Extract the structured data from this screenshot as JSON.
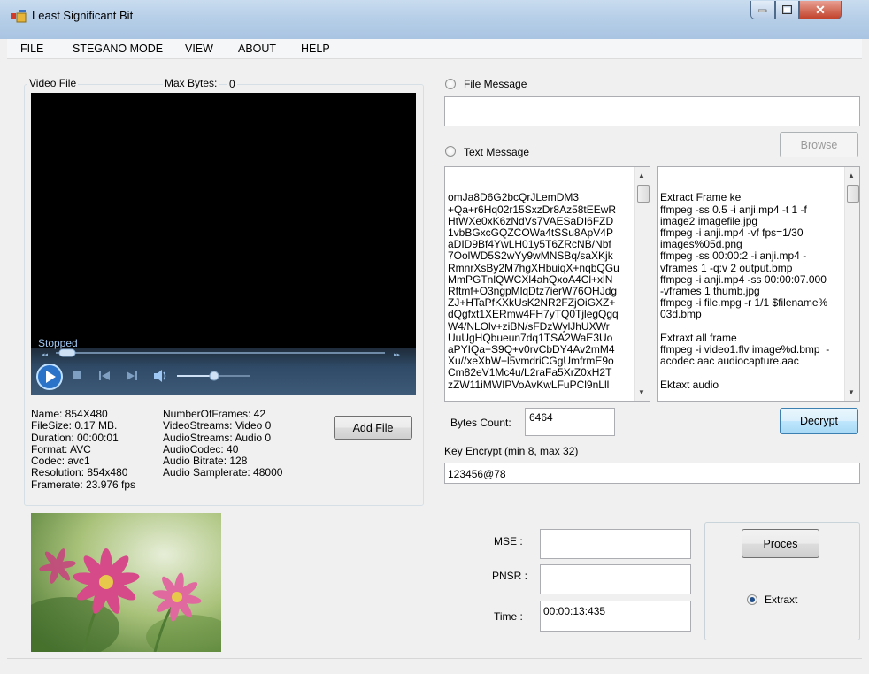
{
  "window": {
    "title": "Least Significant Bit"
  },
  "menu": {
    "items": [
      "FILE",
      "STEGANO MODE",
      "VIEW",
      "ABOUT",
      "HELP"
    ]
  },
  "video_panel": {
    "group_label": "Video File",
    "max_bytes_label": "Max Bytes:",
    "max_bytes_value": "0",
    "player_status": "Stopped"
  },
  "file_info": {
    "left": [
      "Name:    854X480",
      "FileSize: 0.17 MB.",
      "Duration: 00:00:01",
      "Format: AVC",
      "Codec: avc1",
      "Resolution: 854x480",
      "Framerate: 23.976 fps"
    ],
    "right": [
      "NumberOfFrames: 42",
      "VideoStreams: Video 0",
      "AudioStreams: Audio 0",
      "AudioCodec: 40",
      "Audio Bitrate: 128",
      "Audio Samplerate: 48000"
    ],
    "add_file_label": "Add File"
  },
  "message": {
    "file_message_label": "File Message",
    "file_message_value": "",
    "browse_label": "Browse",
    "text_message_label": "Text Message",
    "ciphertext_lines": [
      "omJa8D6G2bcQrJLemDM3",
      "+Qa+r6Hq02r15SxzDr8Az58tEEwR",
      "HtWXe0xK6zNdVs7VAESaDI6FZD",
      "1vbBGxcGQZCOWa4tSSu8ApV4P",
      "aDID9Bf4YwLH01y5T6ZRcNB/Nbf",
      "7OolWD5S2wYy9wMNSBq/saXKjk",
      "RmnrXsBy2M7hgXHbuiqX+nqbQGu",
      "MmPGTnlQWCXl4ahQxoA4Cl+xlN",
      "Rftmf+O3ngpMlqDtz7ierW76OHJdg",
      "ZJ+HTaPfKXkUsK2NR2FZjOiGXZ+",
      "dQgfxt1XERmw4FH7yTQ0TjlegQgq",
      "W4/NLOlv+ziBN/sFDzWylJhUXWr",
      "UuUgHQbueun7dq1TSA2WaE3Uo",
      "aPYIQa+S9Q+v0rvCbDY4Av2mM4",
      "Xu//xeXbW+l5vmdriCGgUmfrmE9o",
      "Cm82eV1Mc4u/L2raFa5XrZ0xH2T",
      "zZW11iMWIPVoAvKwLFuPCl9nLll"
    ],
    "notes_lines": [
      "Extract Frame ke",
      "ffmpeg -ss 0.5 -i anji.mp4 -t 1 -f",
      "image2 imagefile.jpg",
      "ffmpeg -i anji.mp4 -vf fps=1/30",
      "images%05d.png",
      "ffmpeg -ss 00:00:2 -i anji.mp4 -",
      "vframes 1 -q:v 2 output.bmp",
      "ffmpeg -i anji.mp4 -ss 00:00:07.000",
      "-vframes 1 thumb.jpg",
      "ffmpeg -i file.mpg -r 1/1 $filename%",
      "03d.bmp",
      "",
      "Extraxt all frame",
      "ffmpeg -i video1.flv image%d.bmp  -",
      "acodec aac audiocapture.aac",
      "",
      "Ektaxt audio"
    ],
    "bytes_count_label": "Bytes Count:",
    "bytes_count_value": "6464",
    "decrypt_label": "Decrypt",
    "key_label": "Key Encrypt (min 8, max 32)",
    "key_value": "123456@78"
  },
  "metrics": {
    "mse_label": "MSE :",
    "mse_value": "",
    "pnsr_label": "PNSR :",
    "pnsr_value": "",
    "time_label": "Time :",
    "time_value": "00:00:13:435"
  },
  "process": {
    "proces_label": "Proces",
    "extract_label": "Extraxt"
  }
}
